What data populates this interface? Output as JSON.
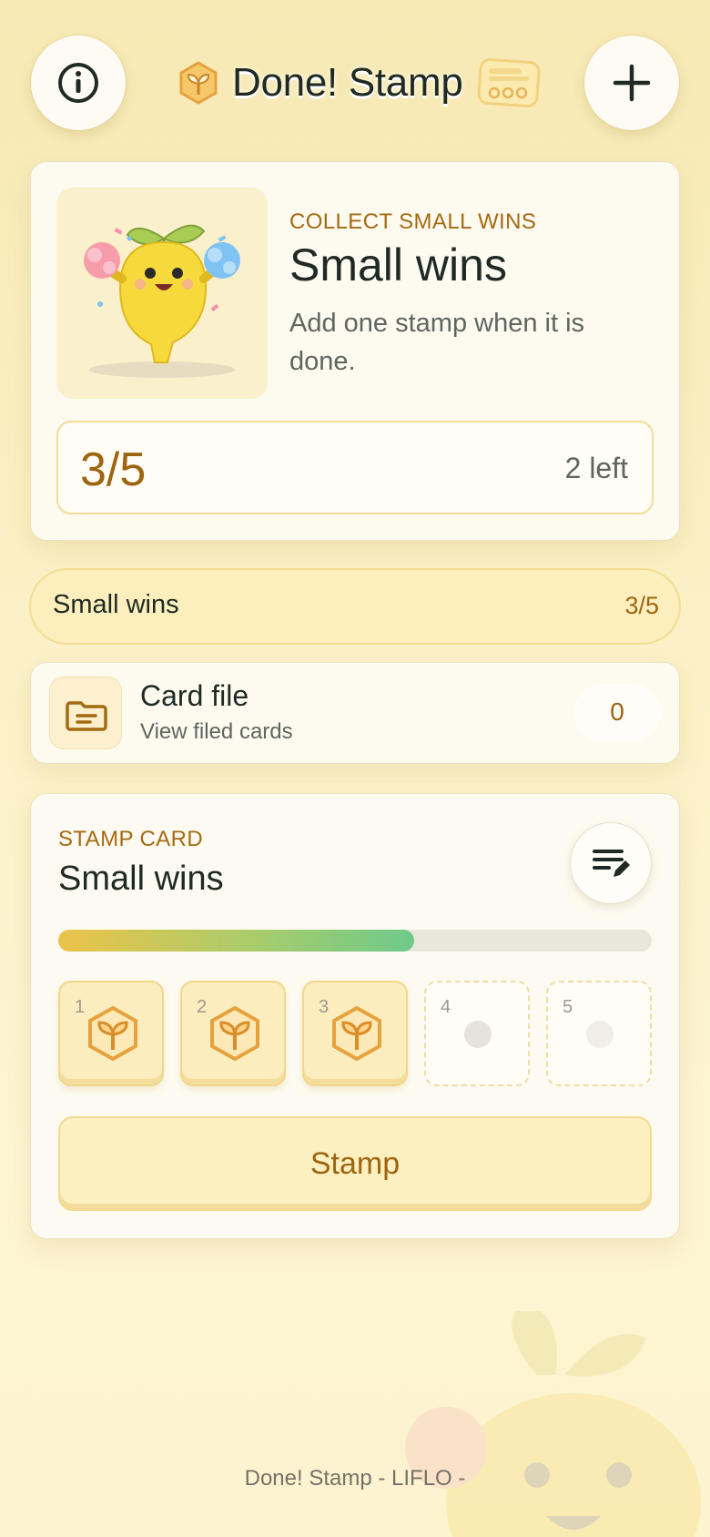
{
  "app": {
    "title": "Done! Stamp"
  },
  "header": {
    "info_icon": "info-icon",
    "add_icon": "plus-icon"
  },
  "hero": {
    "eyebrow": "COLLECT SMALL WINS",
    "title": "Small wins",
    "description": "Add one stamp when it is done.",
    "progress_text": "3/5",
    "remaining_text": "2 left"
  },
  "selector": {
    "label": "Small wins",
    "count": "3/5"
  },
  "card_file": {
    "title": "Card file",
    "subtitle": "View filed cards",
    "count": "0"
  },
  "stamp_card": {
    "eyebrow": "STAMP CARD",
    "title": "Small wins",
    "progress_fraction": 0.6,
    "slots": [
      {
        "number": "1",
        "stamped": true
      },
      {
        "number": "2",
        "stamped": true
      },
      {
        "number": "3",
        "stamped": true
      },
      {
        "number": "4",
        "stamped": false
      },
      {
        "number": "5",
        "stamped": false
      }
    ],
    "button_label": "Stamp"
  },
  "footer": {
    "text": "Done! Stamp - LIFLO -"
  },
  "colors": {
    "accent": "#a46a12",
    "progress_start": "#ecc349",
    "progress_end": "#6ec98a",
    "stamp_fill": "#fcedbf"
  }
}
